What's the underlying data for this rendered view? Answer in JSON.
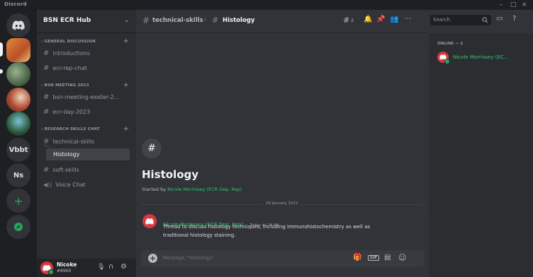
{
  "app": {
    "title": "Discord"
  },
  "server_rail": {
    "servers": [
      {
        "label": "",
        "icon": "discord-home-icon",
        "color": "#313338"
      },
      {
        "label": "",
        "icon": "server-bsn-ecr-hub",
        "color": "#c8743a"
      },
      {
        "label": "",
        "icon": "server-image-2",
        "color": "#4a6b4a"
      },
      {
        "label": "",
        "icon": "server-image-3",
        "color": "#8a4a32"
      },
      {
        "label": "",
        "icon": "server-image-4",
        "color": "#2c4a3a"
      },
      {
        "label": "Vbbt",
        "color": "#313338"
      },
      {
        "label": "Ns",
        "color": "#313338"
      }
    ],
    "add_label": "+",
    "explore_icon": "compass-icon"
  },
  "guild": {
    "name": "BSN ECR Hub"
  },
  "categories": [
    {
      "name": "GENERAL DISCUSSION",
      "channels": [
        "introductions",
        "ecr-rep-chat"
      ]
    },
    {
      "name": "BSN MEETING 2023",
      "channels": [
        "bsn-meeting-exeter-2...",
        "ecr-day-2023"
      ]
    },
    {
      "name": "RESEARCH SKILLS CHAT",
      "channels": [
        "technical-skills",
        "Histology",
        "soft-skills",
        "Voice Chat"
      ]
    }
  ],
  "user": {
    "name": "Nicoke",
    "tag": "#8969"
  },
  "header": {
    "channel": "technical-skills",
    "thread": "Histology",
    "threads_count": "2"
  },
  "search": {
    "placeholder": "Search"
  },
  "thread": {
    "title": "Histology",
    "started_by_prefix": "Started by ",
    "started_by_name": "Nicole Morrissey (ECR Dep. Rep)",
    "date_divider": "29 January 2023"
  },
  "message": {
    "author": "Nicole Morrissey (ECR Dep. Rep)",
    "timestamp": "Today at 16:46",
    "text_line1": "Thread to discuss histology techniques, including immunohistochemistry as well as",
    "text_line2": "traditional histology staining."
  },
  "composer": {
    "placeholder": "Message \"Histology\""
  },
  "members": {
    "online_header": "ONLINE — 1",
    "items": [
      {
        "name": "Nicole Morrissey (EC..."
      }
    ]
  },
  "colors": {
    "accent_name": "#2dc770",
    "bg": "#313338",
    "sidebar": "#2b2d31",
    "rail": "#1e1f22"
  }
}
